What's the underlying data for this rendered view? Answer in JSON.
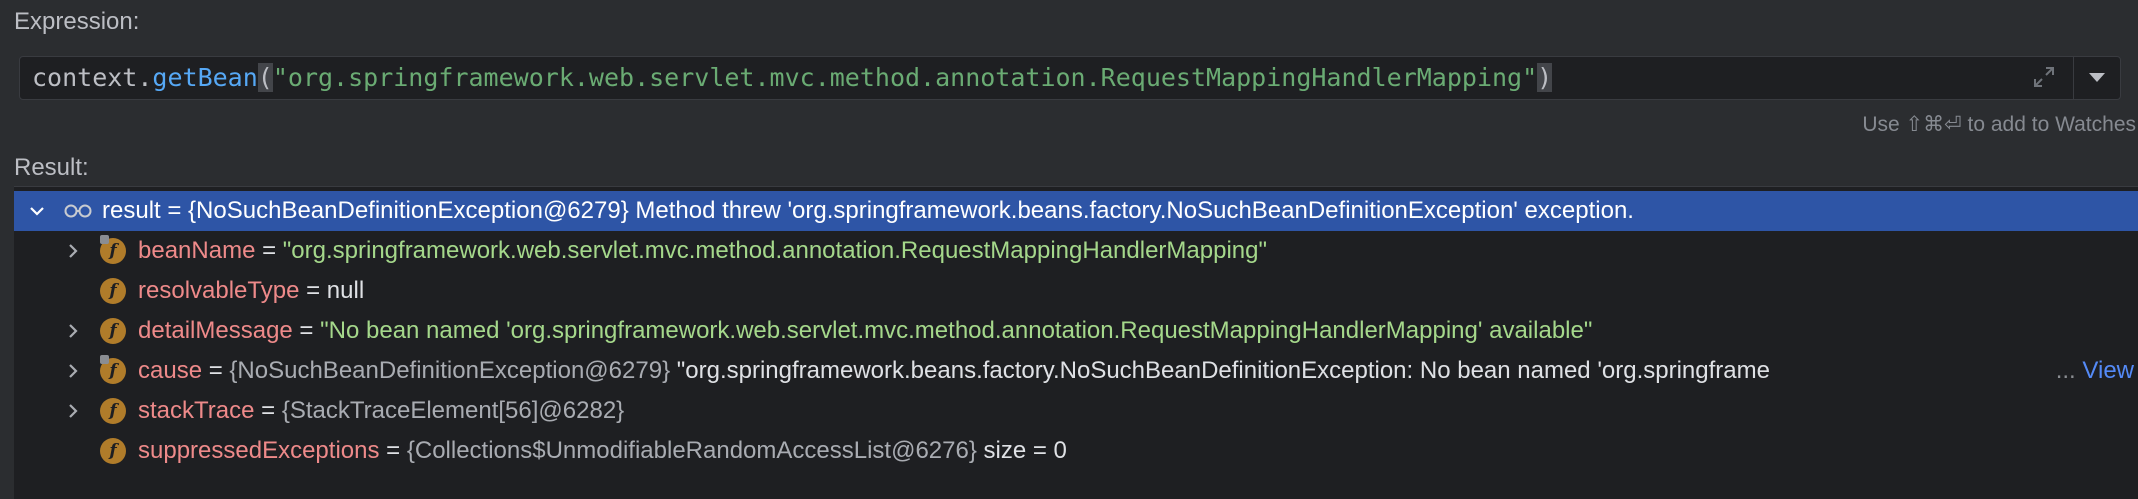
{
  "expression": {
    "label": "Expression:",
    "code": {
      "ident": "context.",
      "method": "getBean",
      "open_paren": "(",
      "string": "\"org.springframework.web.servlet.mvc.method.annotation.RequestMappingHandlerMapping\"",
      "close_paren": ")"
    },
    "hint": "Use ⇧⌘⏎ to add to Watches"
  },
  "result": {
    "label": "Result:",
    "root": {
      "text": "result = {NoSuchBeanDefinitionException@6279} Method threw 'org.springframework.beans.factory.NoSuchBeanDefinitionException' exception."
    },
    "fields": [
      {
        "name": "beanName",
        "eq": " = ",
        "value": "\"org.springframework.web.servlet.mvc.method.annotation.RequestMappingHandlerMapping\"",
        "type": "string"
      },
      {
        "name": "resolvableType",
        "eq": " = ",
        "value": "null",
        "type": "plain"
      },
      {
        "name": "detailMessage",
        "eq": " = ",
        "value": "\"No bean named 'org.springframework.web.servlet.mvc.method.annotation.RequestMappingHandlerMapping' available\"",
        "type": "string"
      },
      {
        "name": "cause",
        "eq": " = ",
        "obj": "{NoSuchBeanDefinitionException@6279}",
        "value": " \"org.springframework.beans.factory.NoSuchBeanDefinitionException: No bean named 'org.springframe",
        "ellipsis": "...",
        "link": "View"
      },
      {
        "name": "stackTrace",
        "eq": " = ",
        "obj": "{StackTraceElement[56]@6282}"
      },
      {
        "name": "suppressedExceptions",
        "eq": " = ",
        "obj": "{Collections$UnmodifiableRandomAccessList@6276}",
        "value": "  size = 0"
      }
    ]
  },
  "colors": {
    "background": "#2b2d30",
    "selection": "#2e55a6",
    "field_name": "#ee8a8a",
    "string": "#a5d88b",
    "link": "#548af7"
  }
}
